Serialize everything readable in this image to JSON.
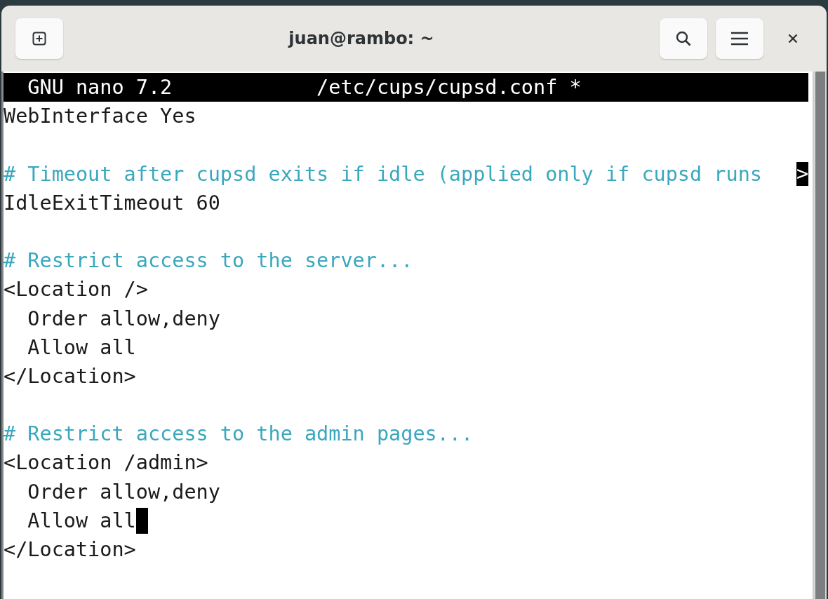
{
  "window": {
    "title": "juan@rambo: ~"
  },
  "nano": {
    "title_bar": "  GNU nano 7.2            /etc/cups/cupsd.conf *",
    "lines": [
      {
        "kind": "text",
        "text": "WebInterface Yes"
      },
      {
        "kind": "blank"
      },
      {
        "kind": "comment",
        "text": "# Timeout after cupsd exits if idle (applied only if cupsd runs ",
        "overflow_marker": ">"
      },
      {
        "kind": "text",
        "text": "IdleExitTimeout 60"
      },
      {
        "kind": "blank"
      },
      {
        "kind": "comment",
        "text": "# Restrict access to the server..."
      },
      {
        "kind": "text",
        "text": "<Location />"
      },
      {
        "kind": "text",
        "text": "  Order allow,deny"
      },
      {
        "kind": "text",
        "text": "  Allow all"
      },
      {
        "kind": "text",
        "text": "</Location>"
      },
      {
        "kind": "blank"
      },
      {
        "kind": "comment",
        "text": "# Restrict access to the admin pages..."
      },
      {
        "kind": "text",
        "text": "<Location /admin>"
      },
      {
        "kind": "text",
        "text": "  Order allow,deny"
      },
      {
        "kind": "text",
        "text": "  Allow all",
        "cursor": true
      },
      {
        "kind": "text",
        "text": "</Location>"
      }
    ]
  }
}
